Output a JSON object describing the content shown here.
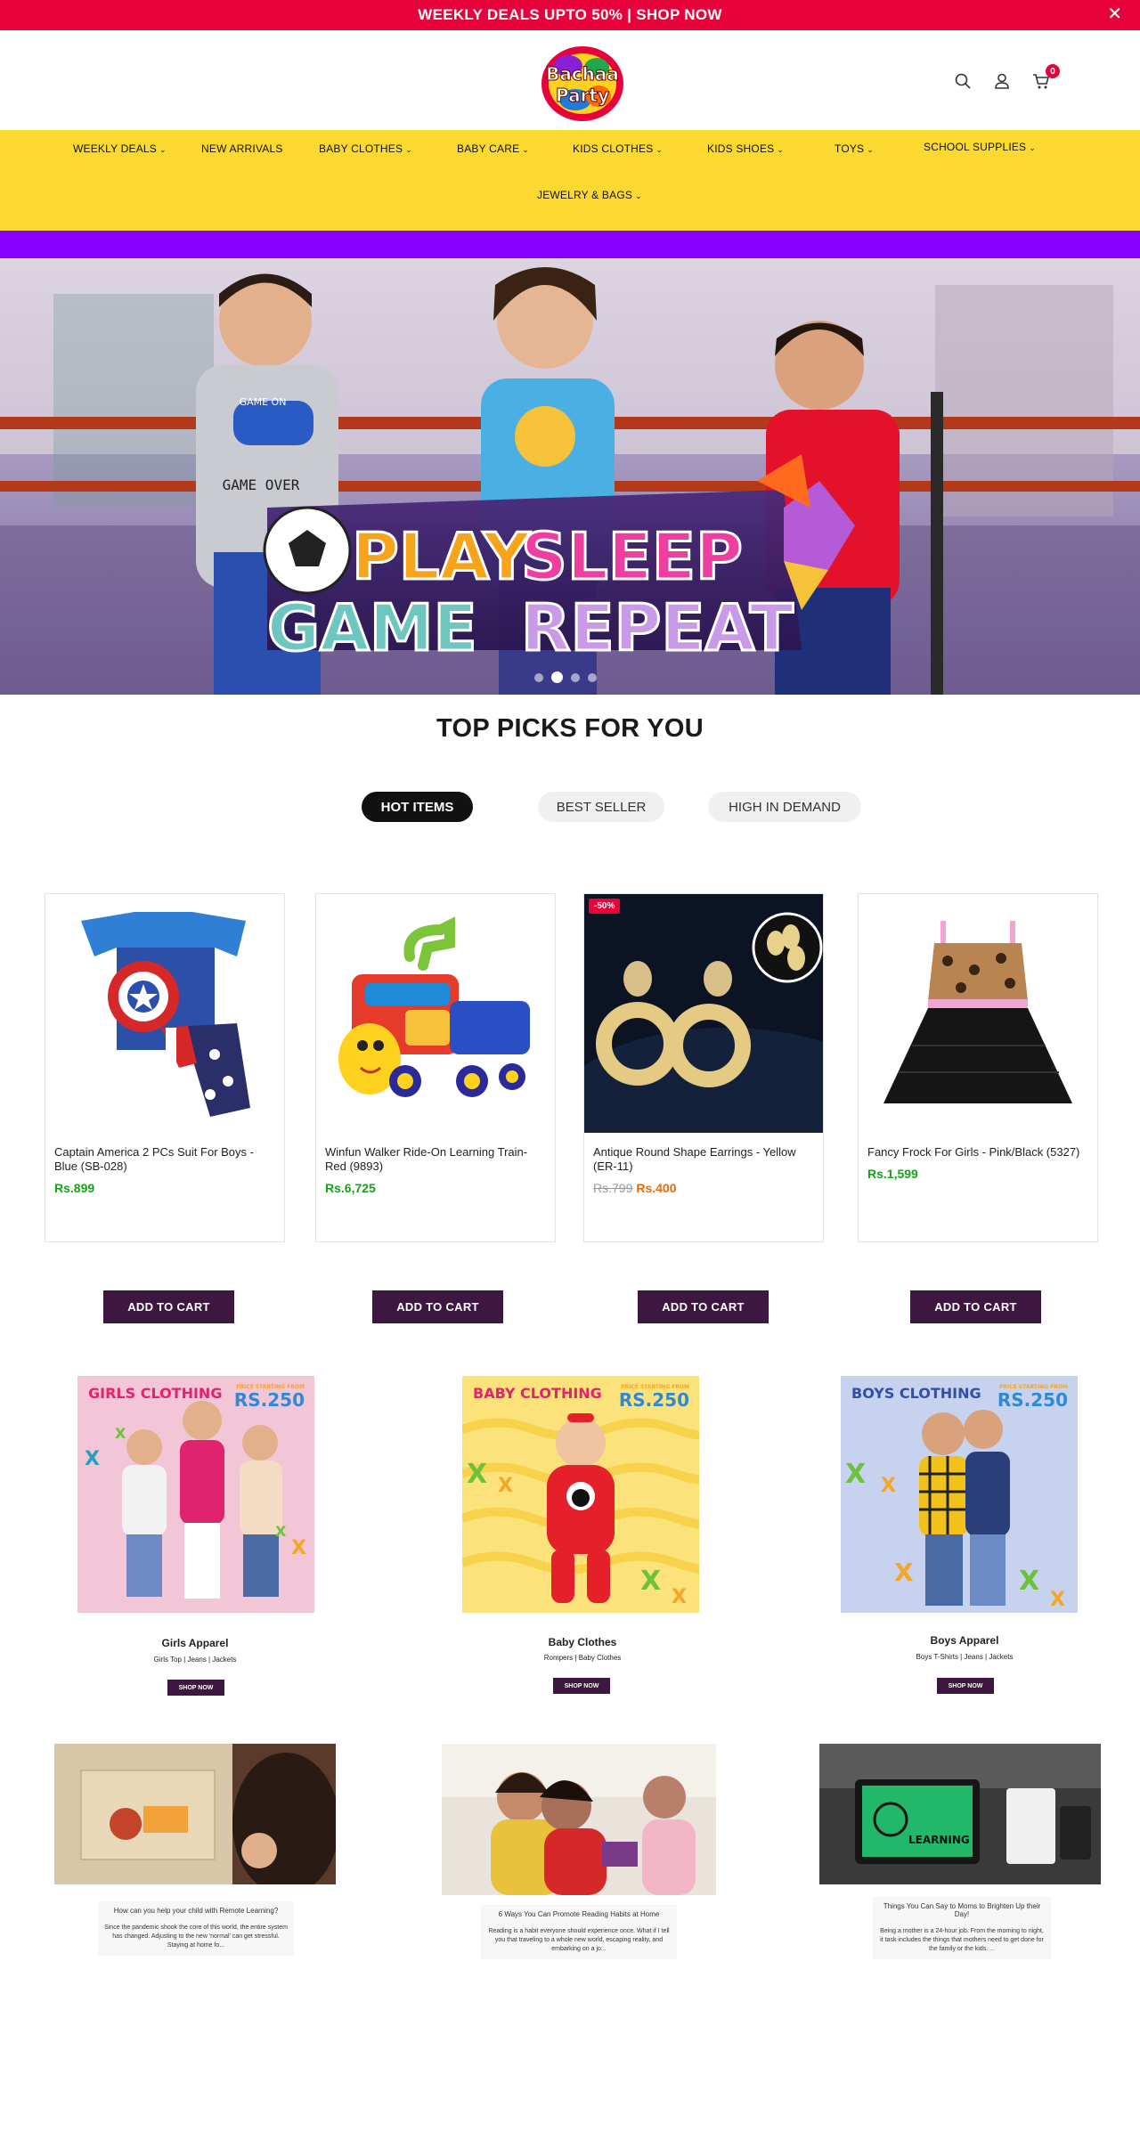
{
  "announcement": {
    "text": "WEEKLY DEALS UPTO 50% | SHOP NOW",
    "close": "✕"
  },
  "header": {
    "logo_alt": "Bachaa Party",
    "cart_count": "0"
  },
  "nav": {
    "items": [
      {
        "label": "WEEKLY DEALS",
        "chevron": true
      },
      {
        "label": "NEW ARRIVALS",
        "chevron": false
      },
      {
        "label": "BABY CLOTHES",
        "chevron": true
      },
      {
        "label": "BABY CARE",
        "chevron": true
      },
      {
        "label": "KIDS CLOTHES",
        "chevron": true
      },
      {
        "label": "KIDS SHOES",
        "chevron": true
      },
      {
        "label": "TOYS",
        "chevron": true
      },
      {
        "label": "SCHOOL SUPPLIES",
        "chevron": true
      },
      {
        "label": "JEWELRY & BAGS",
        "chevron": true
      }
    ]
  },
  "hero": {
    "line1_a": "PLAY",
    "line1_b": "SLEEP",
    "line2_a": "GAME",
    "line2_b": "REPEAT",
    "shirt1": "GAME ON",
    "shirt1b": "GAME OVER",
    "slides": 4,
    "active_slide": 2
  },
  "top_picks": {
    "title": "TOP PICKS FOR YOU",
    "tabs": [
      "HOT ITEMS",
      "BEST SELLER",
      "HIGH IN DEMAND"
    ],
    "active_tab": 0
  },
  "products": [
    {
      "title": "Captain America 2 PCs Suit For Boys - Blue (SB-028)",
      "price": "Rs.899",
      "old_price": "",
      "badge": "",
      "cta": "ADD TO CART"
    },
    {
      "title": "Winfun Walker Ride-On Learning Train- Red (9893)",
      "price": "Rs.6,725",
      "old_price": "",
      "badge": "",
      "cta": "ADD TO CART"
    },
    {
      "title": "Antique Round Shape Earrings - Yellow (ER-11)",
      "price": "Rs.400",
      "old_price": "Rs.799",
      "badge": "-50%",
      "cta": "ADD TO CART"
    },
    {
      "title": "Fancy Frock For Girls - Pink/Black (5327)",
      "price": "Rs.1,599",
      "old_price": "",
      "badge": "",
      "cta": "ADD TO CART"
    }
  ],
  "categories": [
    {
      "banner_label": "GIRLS CLOTHING",
      "price_tag": "PRICE STARTING FROM",
      "price": "RS.250",
      "name": "Girls Apparel",
      "sub": "Girls Top | Jeans | Jackets",
      "cta": "SHOP NOW"
    },
    {
      "banner_label": "BABY CLOTHING",
      "price_tag": "PRICE STARTING FROM",
      "price": "RS.250",
      "name": "Baby Clothes",
      "sub": "Rompers | Baby Clothes",
      "cta": "SHOP NOW"
    },
    {
      "banner_label": "BOYS CLOTHING",
      "price_tag": "PRICE STARTING FROM",
      "price": "RS.250",
      "name": "Boys Apparel",
      "sub": "Boys T-Shirts | Jeans | Jackets",
      "cta": "SHOP NOW"
    }
  ],
  "blogs": [
    {
      "title": "How can you help your child with Remote Learning?",
      "excerpt": "Since the pandemic shook the core of this world, the entire system has changed. Adjusting to the new 'normal' can get stressful.   Staying at home fo..."
    },
    {
      "title": "6 Ways You Can Promote Reading Habits at Home",
      "excerpt": "Reading is a habit everyone should experience once. What if I tell you that traveling to a whole new world, escaping reality, and embarking on a jo..."
    },
    {
      "title": "Things You Can Say to Moms to Brighten Up their Day!",
      "excerpt": "Being a mother is a 24-hour job. From the morning to night, it task includes the things that mothers need to get done for the family or the kids. ..."
    }
  ],
  "learning_screen": "LEARNING"
}
